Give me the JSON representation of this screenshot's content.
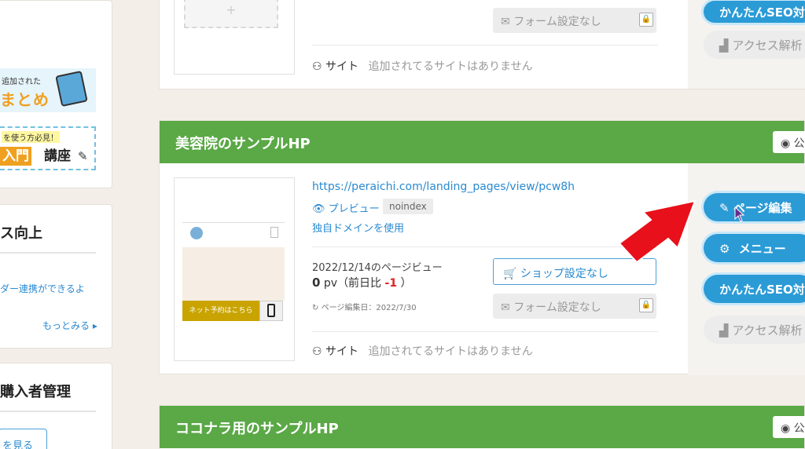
{
  "sidebar": {
    "banner1": {
      "small_text": "追加された",
      "big_text": "まとめ"
    },
    "banner2": {
      "small_text": "を使う方必見！",
      "nyumon": "入門",
      "koza": "講座"
    },
    "section1": {
      "title": "ス向上",
      "link_text": "ダー連携ができるよ",
      "more_link": "もっとみる ▸"
    },
    "section2": {
      "title": "購入者管理",
      "button_label": "を見る"
    }
  },
  "cards": {
    "top": {
      "form_label": "フォーム設定なし",
      "site_label": "サイト",
      "site_empty": "追加されてるサイトはありません",
      "actions": {
        "seo": "かんたんSEO対策",
        "access": "アクセス解析"
      }
    },
    "main": {
      "title": "美容院のサンプルHP",
      "badge": "公",
      "url": "https://peraichi.com/landing_pages/view/pcw8h",
      "preview": "プレビュー",
      "noindex": "noindex",
      "domain": "独自ドメインを使用",
      "pv_date": "2022/12/14のページビュー",
      "pv_count": "0",
      "pv_unit": "pv（前日比",
      "pv_diff": "-1",
      "pv_close": "）",
      "edit_date": "ページ編集日：2022/7/30",
      "shop_label": "ショップ設定なし",
      "form_label": "フォーム設定なし",
      "site_label": "サイト",
      "site_empty": "追加されてるサイトはありません",
      "thumb_cta": "ネット予約はこちら",
      "actions": {
        "edit": "ページ編集",
        "menu": "メニュー",
        "seo": "かんたんSEO対策",
        "access": "アクセス解析"
      }
    },
    "bottom": {
      "title": "ココナラ用のサンプルHP",
      "badge": "公"
    }
  },
  "colors": {
    "green_header": "#5aa846",
    "action_blue": "#2b9bd6",
    "link_blue": "#2a8ad0",
    "arrow_red": "#e8101a"
  }
}
